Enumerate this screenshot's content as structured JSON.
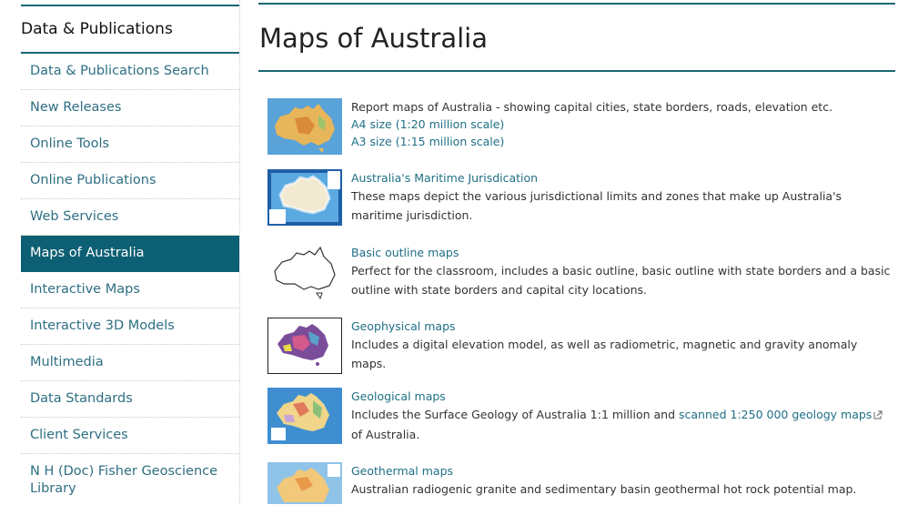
{
  "sidebar": {
    "heading": "Data & Publications",
    "items": [
      {
        "label": "Data & Publications Search",
        "active": false
      },
      {
        "label": "New Releases",
        "active": false
      },
      {
        "label": "Online Tools",
        "active": false
      },
      {
        "label": "Online Publications",
        "active": false
      },
      {
        "label": "Web Services",
        "active": false
      },
      {
        "label": "Maps of Australia",
        "active": true
      },
      {
        "label": "Interactive Maps",
        "active": false
      },
      {
        "label": "Interactive 3D Models",
        "active": false
      },
      {
        "label": "Multimedia",
        "active": false
      },
      {
        "label": "Data Standards",
        "active": false
      },
      {
        "label": "Client Services",
        "active": false
      },
      {
        "label": "N H (Doc) Fisher Geoscience Library",
        "active": false
      }
    ]
  },
  "main": {
    "title": "Maps of Australia",
    "entries": [
      {
        "description": "Report maps of Australia - showing capital cities, state borders, roads, elevation etc.",
        "links": [
          "A4 size (1:20 million scale)",
          "A3 size (1:15 million scale)"
        ]
      },
      {
        "title": "Australia's Maritime Jurisdication",
        "description": "These maps depict the various jurisdictional limits and zones that make up Australia's maritime jurisdiction."
      },
      {
        "title": "Basic outline maps",
        "description": "Perfect for the classroom, includes a basic outline, basic outline with state borders and a basic outline with state borders and capital city locations."
      },
      {
        "title": "Geophysical maps",
        "description": "Includes a digital elevation model, as well as radiometric, magnetic and gravity anomaly maps."
      },
      {
        "title": "Geological maps",
        "description_before": "Includes the Surface Geology of Australia 1:1 million and",
        "description_link": "scanned 1:250 000 geology maps",
        "description_after": "of Australia."
      },
      {
        "title": "Geothermal maps",
        "description": "Australian radiogenic granite and sedimentary basin geothermal hot rock potential map."
      }
    ]
  },
  "colors": {
    "accent": "#1d6775",
    "active_bg": "#0d5f73",
    "link": "#1f6f86"
  }
}
